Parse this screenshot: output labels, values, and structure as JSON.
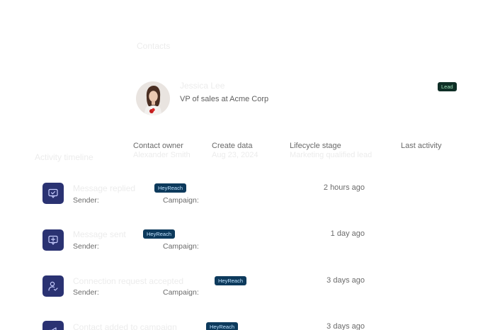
{
  "header": {
    "back_label": "Contacts"
  },
  "contact": {
    "name": "Jessica Lee",
    "title": "VP of sales at Acme Corp",
    "status_badge": "Lead"
  },
  "meta": {
    "owner_label": "Contact owner",
    "owner_value": "Alexander Smith",
    "created_label": "Create data",
    "created_value": "Aug 23, 2024",
    "stage_label": "Lifecycle stage",
    "stage_value": "Marketing qualified lead",
    "activity_label": "Last activity",
    "activity_value": ""
  },
  "feed": {
    "title": "Activity timeline",
    "sender_label": "Sender:",
    "campaign_label": "Campaign:",
    "items": [
      {
        "title": "Message replied",
        "badge": "HeyReach",
        "time": "2 hours ago",
        "icon": "message-check-icon"
      },
      {
        "title": "Message sent",
        "badge": "HeyReach",
        "time": "1 day ago",
        "icon": "message-plus-icon"
      },
      {
        "title": "Connection request accepted",
        "badge": "HeyReach",
        "time": "3 days ago",
        "icon": "user-check-icon"
      },
      {
        "title": "Contact added to campaign",
        "badge": "HeyReach",
        "time": "3 days ago",
        "icon": "megaphone-icon"
      }
    ]
  },
  "colors": {
    "icon_bg": "#2a3272",
    "lead_badge_bg": "#0f2e26",
    "heyreach_badge_bg": "#0d3a5c"
  }
}
